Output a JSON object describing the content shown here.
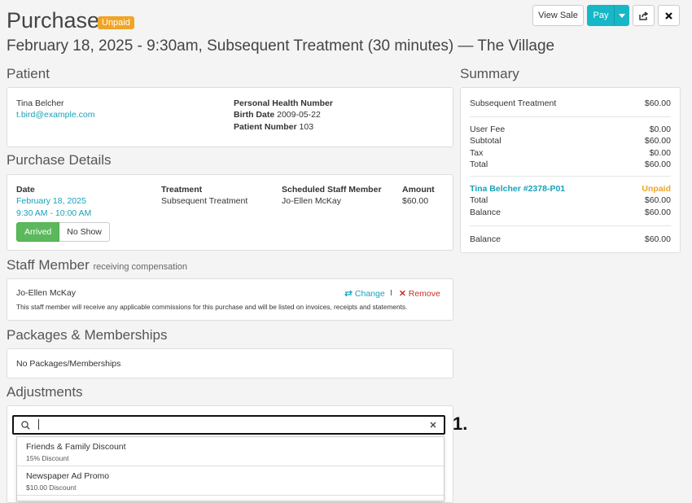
{
  "header": {
    "title": "Purchase",
    "status_badge": "Unpaid",
    "subtitle": "February 18, 2025 - 9:30am, Subsequent Treatment (30 minutes)  — The Village",
    "view_sale_label": "View Sale",
    "pay_label": "Pay",
    "pay_caret_icon": "caret-down-icon",
    "share_icon": "share-icon",
    "close_icon": "close-icon"
  },
  "patient": {
    "heading": "Patient",
    "name": "Tina Belcher",
    "email": "t.bird@example.com",
    "phn_label": "Personal Health Number",
    "birth_label": "Birth Date",
    "birth_value": "2009-05-22",
    "patient_num_label": "Patient Number",
    "patient_num_value": "103"
  },
  "purchase_details": {
    "heading": "Purchase Details",
    "columns": [
      "Date",
      "Treatment",
      "Scheduled Staff Member",
      "Amount"
    ],
    "date": "February 18, 2025",
    "time": "9:30 AM - 10:00 AM",
    "treatment": "Subsequent Treatment",
    "staff": "Jo-Ellen McKay",
    "amount": "$60.00",
    "arrived_label": "Arrived",
    "no_show_label": "No Show"
  },
  "staff_member": {
    "heading": "Staff Member",
    "heading_suffix": "receiving compensation",
    "name": "Jo-Ellen McKay",
    "change_label": "Change",
    "remove_label": "Remove",
    "separator": "I",
    "note": "This staff member will receive any applicable commissions for this purchase and will be listed on invoices, receipts and statements."
  },
  "packages": {
    "heading": "Packages & Memberships",
    "empty_text": "No Packages/Memberships"
  },
  "adjustments": {
    "heading": "Adjustments",
    "search_value": "",
    "search_icon": "search-icon",
    "clear_icon": "clear-icon",
    "options": [
      {
        "name": "Friends & Family Discount",
        "desc": "15% Discount"
      },
      {
        "name": "Newspaper Ad Promo",
        "desc": "$10.00 Discount"
      }
    ],
    "step_label": "1."
  },
  "summary": {
    "heading": "Summary",
    "treatment_label": "Subsequent Treatment",
    "treatment_amount": "$60.00",
    "rows": [
      {
        "label": "User Fee",
        "value": "$0.00"
      },
      {
        "label": "Subtotal",
        "value": "$60.00"
      },
      {
        "label": "Tax",
        "value": "$0.00"
      },
      {
        "label": "Total",
        "value": "$60.00"
      }
    ],
    "invoice_label": "Tina Belcher #2378-P01",
    "invoice_status": "Unpaid",
    "invoice_rows": [
      {
        "label": "Total",
        "value": "$60.00"
      },
      {
        "label": "Balance",
        "value": "$60.00"
      }
    ],
    "final_label": "Balance",
    "final_value": "$60.00"
  },
  "colors": {
    "accent": "#17b7c7",
    "link": "#17a2b8",
    "unpaid": "#f0a526",
    "arrived": "#5cb85c",
    "remove": "#c9302c"
  }
}
